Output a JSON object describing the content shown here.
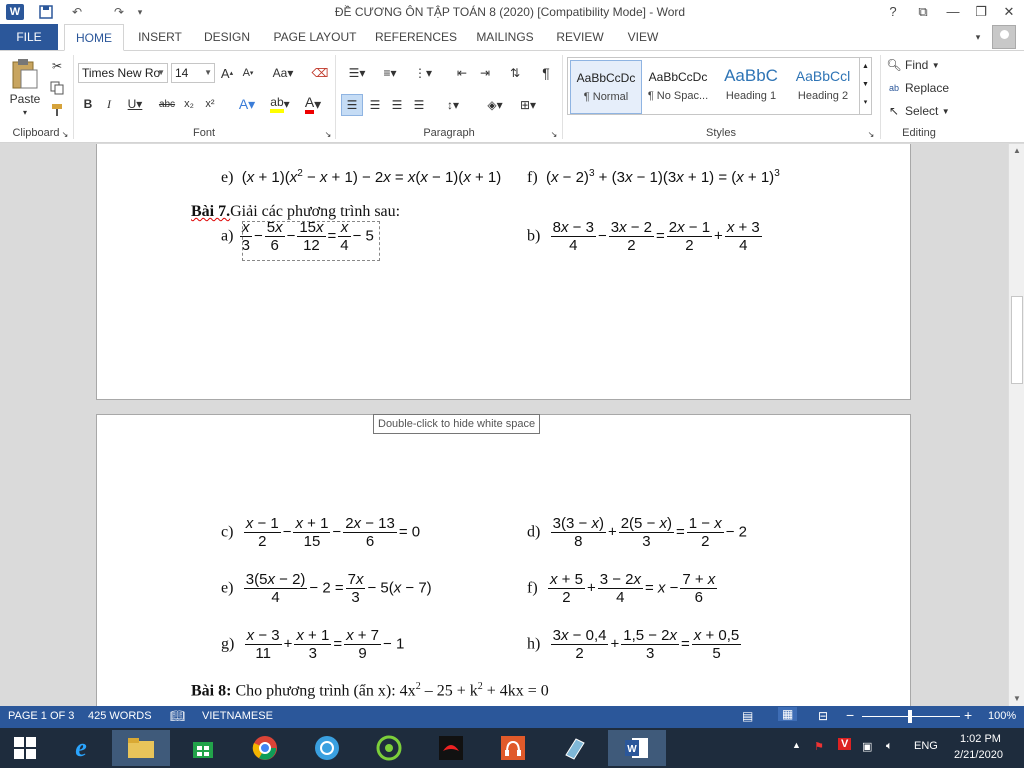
{
  "window": {
    "title": "ĐỀ CƯƠNG ÔN TẬP TOÁN 8 (2020) [Compatibility Mode] - Word",
    "controls": {
      "help": "?",
      "ribbon_display": "⧉",
      "minimize": "—",
      "restore": "❐",
      "close": "✕"
    }
  },
  "tabs": {
    "file": "FILE",
    "items": [
      "HOME",
      "INSERT",
      "DESIGN",
      "PAGE LAYOUT",
      "REFERENCES",
      "MAILINGS",
      "REVIEW",
      "VIEW"
    ],
    "active": "HOME"
  },
  "ribbon": {
    "clipboard": {
      "paste": "Paste",
      "label": "Clipboard"
    },
    "font": {
      "name": "Times New Ro",
      "size": "14",
      "label": "Font"
    },
    "paragraph": {
      "label": "Paragraph"
    },
    "styles": {
      "label": "Styles",
      "items": [
        {
          "preview": "AaBbCcDc",
          "name": "¶ Normal"
        },
        {
          "preview": "AaBbCcDc",
          "name": "¶ No Spac..."
        },
        {
          "preview": "AaBbC",
          "name": "Heading 1"
        },
        {
          "preview": "AaBbCcl",
          "name": "Heading 2"
        }
      ]
    },
    "editing": {
      "find": "Find",
      "replace": "Replace",
      "select": "Select",
      "label": "Editing"
    }
  },
  "document": {
    "bai7_label": "Bài 7.",
    "bai7_title": "Giải các phương trình sau:",
    "bai8_label": "Bài 8:",
    "bai8_text": "Cho phương trình (ẩn x): 4x",
    "bai8_rest": " – 25 + k",
    "bai8_end": " + 4kx = 0",
    "sup2": "2",
    "labels": {
      "e1": "e)",
      "f1": "f)",
      "a": "a)",
      "b": "b)",
      "c": "c)",
      "d": "d)",
      "e2": "e)",
      "f2": "f)",
      "g": "g)",
      "h": "h)"
    },
    "tooltip": "Double-click to hide white space"
  },
  "status": {
    "page": "PAGE 1 OF 3",
    "words": "425 WORDS",
    "language": "VIETNAMESE",
    "zoom": "100%"
  },
  "taskbar": {
    "language": "ENG",
    "time": "1:02 PM",
    "date": "2/21/2020"
  },
  "colors": {
    "accent": "#2b579a",
    "taskbar": "#1e2c3d"
  }
}
